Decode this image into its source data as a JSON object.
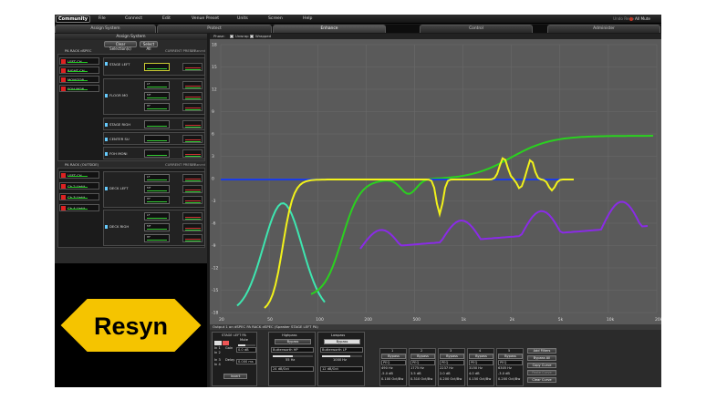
{
  "app": {
    "logo": "Community"
  },
  "menu": [
    "File",
    "Connect",
    "Edit",
    "Venue Preset",
    "Units",
    "Screen",
    "Help"
  ],
  "toolbar": {
    "undo_redo": "Undo Redo",
    "all_mute": "All Mute"
  },
  "tabs": [
    {
      "label": "Assign System",
      "active": false
    },
    {
      "label": "Protect",
      "active": false
    },
    {
      "label": "Enhance",
      "active": true
    },
    {
      "label": "Control",
      "active": false
    },
    {
      "label": "Administer",
      "active": false
    }
  ],
  "left": {
    "header": "Assign System",
    "clear_selection": "Clear Selection(s)",
    "select_all": "Select All",
    "rack1": {
      "title": "PA RACK dSPEC",
      "current_preset": "CURRENT PRESET :",
      "unsaved": "unsaved",
      "channels": [
        "LEFT CH",
        "RIGHT CH",
        "MONITOR",
        "FOH MON"
      ],
      "speakers": [
        {
          "name": "STAGE LEFT",
          "bands": [
            "",
            "",
            ""
          ]
        },
        {
          "name": "FLOOR MO",
          "bands": [
            "LF",
            "MF",
            "HF"
          ]
        },
        {
          "name": "STAGE RIGH",
          "bands": [
            ""
          ]
        },
        {
          "name": "CENTER SU",
          "bands": [
            ""
          ]
        },
        {
          "name": "FOH MONI",
          "bands": [
            ""
          ]
        }
      ]
    },
    "rack2": {
      "title": "PA RACK (OUTSIDE)",
      "current_preset": "CURRENT PRESET :",
      "unsaved": "unsaved",
      "channels": [
        "LEFT CH",
        "Ch 2 Untit",
        "Ch 3 Untit",
        "Ch 4 Untit"
      ],
      "speakers": [
        {
          "name": "DECK LEFT",
          "bands": [
            "LF",
            "MF",
            "HF"
          ]
        },
        {
          "name": "DECK RIGH",
          "bands": [
            "LF",
            "MF",
            "HF"
          ]
        }
      ]
    },
    "brand": "Resyn"
  },
  "plot": {
    "phase_label": "Phase:",
    "unwrap": "Unwrap",
    "wrapped": "Wrapped",
    "y_ticks": [
      "18",
      "15",
      "12",
      "9",
      "6",
      "3",
      "0",
      "-3",
      "-6",
      "-9",
      "-12",
      "-15",
      "-18"
    ],
    "x_ticks": [
      "20",
      "50",
      "100",
      "200",
      "500",
      "1k",
      "2k",
      "5k",
      "10k",
      "20k"
    ],
    "colors": {
      "blue": "#1a3be6",
      "yellow": "#f2f21a",
      "green": "#2ad11f",
      "teal": "#3ee6b0",
      "purple": "#8a2be6"
    }
  },
  "bottom": {
    "title": "Output 1 on dSPEC PA RACK dSPEC (Speaker STAGE LEFT PA)",
    "speaker": {
      "name": "STAGE LEFT PA",
      "mute": "Mute",
      "gain_label": "Gain",
      "gain_value": "0.0 dB",
      "delay_label": "Delay",
      "delay_value": "0.000 ms",
      "in_labels": [
        "In 1",
        "In 2",
        "In 3",
        "In 4"
      ],
      "invert": "Invert"
    },
    "highpass": {
      "title": "Highpass",
      "bypass": "Bypass",
      "type": "Butterworth HP",
      "freq": "55 Hz",
      "slope": "24 dB/Oct"
    },
    "lowpass": {
      "title": "Lowpass",
      "bypass": "Bypass",
      "type": "Butterworth LP",
      "freq": "1000 Hz",
      "slope": "12 dB/Oct"
    },
    "peq": [
      {
        "num": "1",
        "bypass": "Bypass",
        "type": "PEQ",
        "freq": "490 Hz",
        "gain": "-5.0 dB",
        "q": "0.100 Oct/Bw"
      },
      {
        "num": "2",
        "bypass": "Bypass",
        "type": "PEQ",
        "freq": "1775 Hz",
        "gain": "3.5 dB",
        "q": "0.310 Oct/Bw"
      },
      {
        "num": "3",
        "bypass": "Bypass",
        "type": "PEQ",
        "freq": "2237 Hz",
        "gain": "2.0 dB",
        "q": "0.200 Oct/Bw"
      },
      {
        "num": "4",
        "bypass": "Bypass",
        "type": "PEQ",
        "freq": "3150 Hz",
        "gain": "4.0 dB",
        "q": "0.150 Oct/Bw"
      },
      {
        "num": "5",
        "bypass": "Bypass",
        "type": "PEQ",
        "freq": "6305 Hz",
        "gain": "-3.0 dB",
        "q": "0.200 Oct/Bw"
      }
    ],
    "actions": [
      "Add Filters",
      "Bypass All",
      "Copy Curve",
      "Paste Curve",
      "Clear Curve"
    ]
  }
}
